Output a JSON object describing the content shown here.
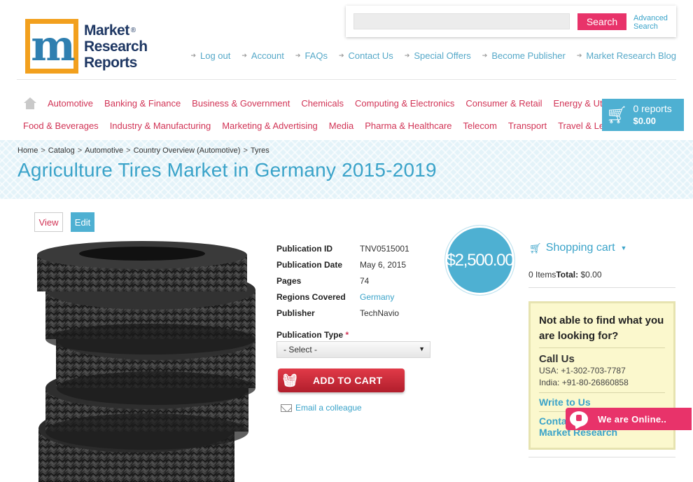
{
  "logo": {
    "line1": "Market",
    "line2": "Research",
    "line3": "Reports",
    "reg": "®"
  },
  "search": {
    "placeholder": "",
    "button": "Search",
    "advanced_line1": "Advanced",
    "advanced_line2": "Search"
  },
  "top_links": [
    "Log out",
    "Account",
    "FAQs",
    "Contact Us",
    "Special Offers",
    "Become Publisher",
    "Market Research Blog"
  ],
  "categories_row1": [
    "Automotive",
    "Banking & Finance",
    "Business & Government",
    "Chemicals",
    "Computing & Electronics",
    "Consumer & Retail",
    "Energy & Utilities"
  ],
  "categories_row2": [
    "Food & Beverages",
    "Industry & Manufacturing",
    "Marketing & Advertising",
    "Media",
    "Pharma & Healthcare",
    "Telecom",
    "Transport",
    "Travel & Leisure"
  ],
  "cart": {
    "count": "0 reports",
    "amount": "$0.00"
  },
  "breadcrumb": [
    "Home",
    "Catalog",
    "Automotive",
    "Country Overview (Automotive)",
    "Tyres"
  ],
  "page_title": "Agriculture Tires Market in Germany 2015-2019",
  "tabs": {
    "view": "View",
    "edit": "Edit"
  },
  "details": [
    {
      "label": "Publication ID",
      "value": "TNV0515001"
    },
    {
      "label": "Publication Date",
      "value": "May 6, 2015"
    },
    {
      "label": "Pages",
      "value": "74"
    },
    {
      "label": "Regions Covered",
      "value": "Germany"
    },
    {
      "label": "Publisher",
      "value": "TechNavio"
    }
  ],
  "pub_type": {
    "label": "Publication Type",
    "required": "*",
    "selected": "- Select -"
  },
  "add_to_cart": "ADD TO CART",
  "email_colleague": "Email a colleague",
  "price": "$2,500.00",
  "shopping_cart": {
    "title": "Shopping cart",
    "items": "0 Items",
    "total_label": "Total:",
    "total": "$0.00"
  },
  "help": {
    "question": "Not able to find what you are looking for?",
    "call_title": "Call Us",
    "usa": "USA: +1-302-703-7787",
    "india": "India: +91-80-26860858",
    "write": "Write to Us",
    "contact_line1": "Conta",
    "contact_line2": "Market Research"
  },
  "chat": "We are Online.."
}
